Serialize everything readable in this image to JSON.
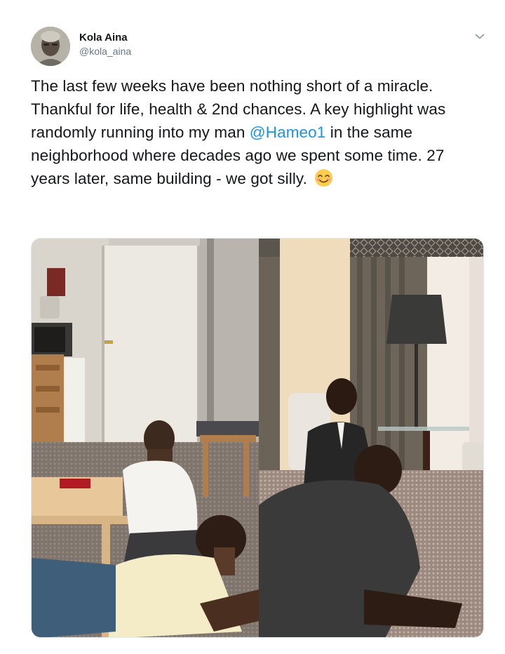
{
  "tweet": {
    "author": {
      "display_name": "Kola Aina",
      "handle": "@kola_aina",
      "avatar_icon": "profile-photo"
    },
    "menu_icon": "chevron-down-icon",
    "text": {
      "part1": "The last few weeks have been nothing short of a miracle. Thankful for life, health & 2nd chances. A key highlight was randomly running into my man ",
      "mention": "@Hameo1",
      "part2": " in the same neighborhood where decades ago we spent some time. 27 years later, same building - we got silly. ",
      "emoji": "smiling-face-with-smiling-eyes"
    },
    "media": {
      "left_photo": "childhood-photo",
      "right_photo": "adult-recreation-photo"
    }
  },
  "colors": {
    "text": "#14171a",
    "secondary": "#657786",
    "link": "#1b95e0"
  }
}
